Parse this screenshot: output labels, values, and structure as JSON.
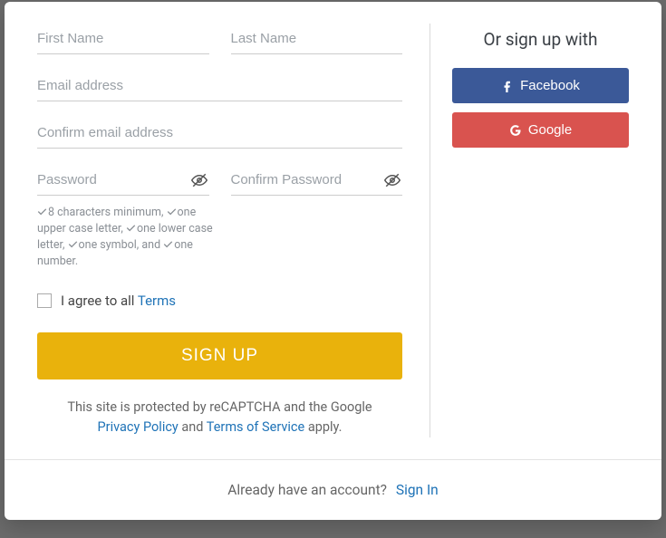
{
  "form": {
    "first_name_ph": "First Name",
    "last_name_ph": "Last Name",
    "email_ph": "Email address",
    "confirm_email_ph": "Confirm email address",
    "password_ph": "Password",
    "confirm_password_ph": "Confirm Password",
    "requirements": {
      "r1": "8 characters minimum,",
      "r2": "one upper case letter,",
      "r3": "one lower case letter,",
      "r4": "one symbol, and",
      "r5": "one number."
    },
    "terms_prefix": "I agree to all ",
    "terms_link": "Terms",
    "signup_label": "SIGN UP",
    "captcha_line1": "This site is protected by reCAPTCHA and the Google",
    "privacy_link": "Privacy Policy",
    "captcha_and": " and ",
    "tos_link": "Terms of Service",
    "captcha_apply": " apply."
  },
  "social": {
    "heading": "Or sign up with",
    "facebook_label": "Facebook",
    "google_label": "Google"
  },
  "footer": {
    "prompt": "Already have an account?",
    "signin": "Sign In"
  },
  "colors": {
    "primary_button": "#e9b20c",
    "facebook": "#3b5998",
    "google": "#d9534f",
    "link": "#1f73b7"
  }
}
